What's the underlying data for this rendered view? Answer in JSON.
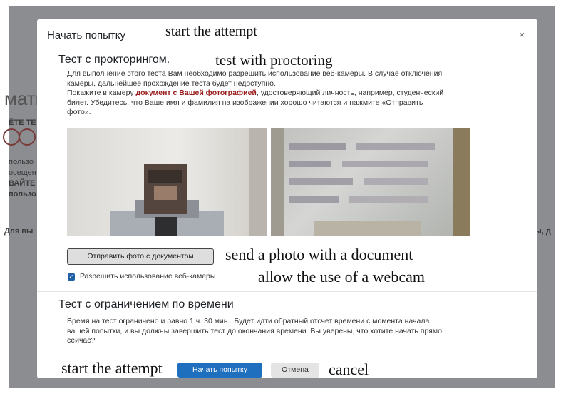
{
  "background": {
    "heading_fragment": "мати",
    "line1": "ЁТЕ ТЕ",
    "line2": "пользо",
    "line3": "осещен",
    "line4": "ВАЙТЕ",
    "line5": "пользо",
    "left_text": "Для вы",
    "right_text": "ты, д"
  },
  "modal": {
    "title": "Начать попытку",
    "close_glyph": "×",
    "proctoring": {
      "title": "Тест с прокторингом.",
      "para1_line1": "Для выполнение этого теста Вам необходимо разрешить использование веб-камеры. В случае отключения",
      "para1_line2": "камеры, дальнейшее прохождение теста будет недоступно.",
      "para2_line1_pre": "Покажите в камеру ",
      "para2_line1_red": "документ с Вашей фотографией",
      "para2_line1_post": ", удостоверяющий личность, например, студенческий",
      "para2_line2": "билет. Убедитесь, что Ваше имя и фамилия на изображении хорошо читаются и нажмите «Отправить",
      "para2_line3": "фото».",
      "send_button": "Отправить фото с документом",
      "webcam_label": "Разрешить использование веб-камеры",
      "webcam_checked": true
    },
    "time_limit": {
      "title": "Тест с ограничением по времени",
      "line1": "Время на тест ограничено и равно 1 ч. 30 мин.. Будет идти обратный отсчет времени с момента начала",
      "line2": "вашей попытки, и вы должны завершить тест до окончания времени. Вы уверены, что хотите начать прямо",
      "line3": "сейчас?"
    },
    "start_button": "Начать попытку",
    "cancel_button": "Отмена"
  },
  "annotations": {
    "start_attempt_title": "start the attempt",
    "proctoring": "test with proctoring",
    "send_photo": "send a photo with a document",
    "allow_webcam": "allow the use of a webcam",
    "start_attempt_bottom": "start the attempt",
    "cancel": "cancel"
  },
  "colors": {
    "primary": "#1f6fbf",
    "checkbox": "#1f5fa5",
    "emphasis": "#9a1b1b"
  }
}
